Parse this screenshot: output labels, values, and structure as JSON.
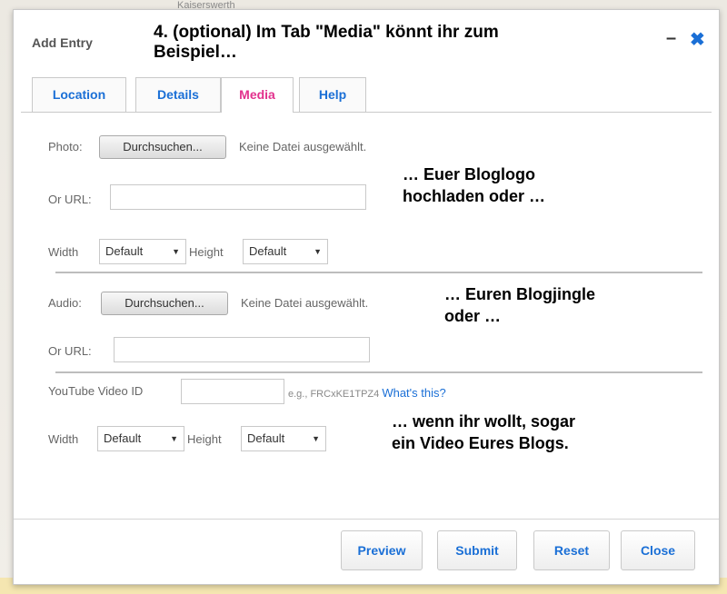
{
  "map": {
    "label_top": "Kaiserswerth"
  },
  "dialog": {
    "title": "Add Entry",
    "minimize_label": "–",
    "close_label": "✖"
  },
  "annotations": {
    "top": "4. (optional) Im Tab \"Media\" könnt ihr zum",
    "top2": "Beispiel…",
    "photo_line1": "… Euer Bloglogo",
    "photo_line2": "hochladen oder …",
    "audio_line1": "… Euren Blogjingle",
    "audio_line2": "oder …",
    "video_line1": "… wenn ihr wollt, sogar",
    "video_line2": "ein Video Eures Blogs."
  },
  "tabs": [
    {
      "label": "Location",
      "active": false
    },
    {
      "label": "Details",
      "active": false
    },
    {
      "label": "Media",
      "active": true
    },
    {
      "label": "Help",
      "active": false
    }
  ],
  "photo": {
    "label": "Photo:",
    "browse": "Durchsuchen...",
    "no_file": "Keine Datei ausgewählt.",
    "url_label": "Or URL:",
    "url_value": "",
    "width_label": "Width",
    "width_value": "Default",
    "height_label": "Height",
    "height_value": "Default"
  },
  "audio": {
    "label": "Audio:",
    "browse": "Durchsuchen...",
    "no_file": "Keine Datei ausgewählt.",
    "url_label": "Or URL:",
    "url_value": ""
  },
  "video": {
    "label": "YouTube Video ID",
    "value": "",
    "example": "e.g., FRCxKE1TPZ4",
    "whats_this": "What's this?",
    "width_label": "Width",
    "width_value": "Default",
    "height_label": "Height",
    "height_value": "Default"
  },
  "footer": {
    "preview": "Preview",
    "submit": "Submit",
    "reset": "Reset",
    "close": "Close"
  },
  "colors": {
    "accent": "#1a6fd6",
    "active_tab": "#e2318d"
  }
}
